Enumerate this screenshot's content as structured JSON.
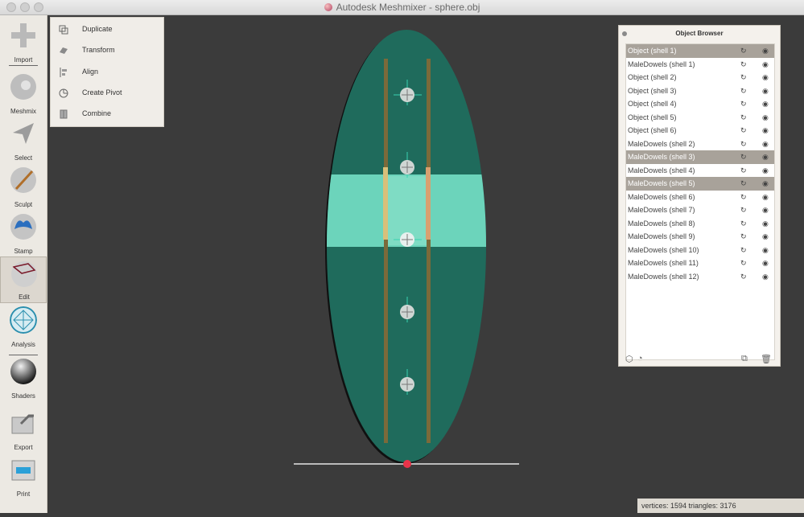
{
  "window": {
    "title": "Autodesk Meshmixer - sphere.obj"
  },
  "toolbar": {
    "items": [
      {
        "label": "Import",
        "icon": "plus-icon"
      },
      {
        "label": "Meshmix",
        "icon": "meshmix-icon"
      },
      {
        "label": "Select",
        "icon": "select-arrow-icon"
      },
      {
        "label": "Sculpt",
        "icon": "brush-icon"
      },
      {
        "label": "Stamp",
        "icon": "stamp-icon"
      },
      {
        "label": "Edit",
        "icon": "edit-icon"
      },
      {
        "label": "Analysis",
        "icon": "analysis-icon"
      },
      {
        "label": "Shaders",
        "icon": "shader-sphere-icon"
      },
      {
        "label": "Export",
        "icon": "export-icon"
      },
      {
        "label": "Print",
        "icon": "printer-icon"
      }
    ]
  },
  "edit_menu": {
    "items": [
      {
        "label": "Duplicate",
        "icon": "duplicate-icon"
      },
      {
        "label": "Transform",
        "icon": "transform-icon"
      },
      {
        "label": "Align",
        "icon": "align-icon"
      },
      {
        "label": "Create Pivot",
        "icon": "pivot-icon"
      },
      {
        "label": "Combine",
        "icon": "combine-icon"
      }
    ]
  },
  "object_browser": {
    "title": "Object Browser",
    "items": [
      {
        "label": "Object (shell 1)",
        "selected": true
      },
      {
        "label": "MaleDowels (shell 1)",
        "selected": false
      },
      {
        "label": "Object (shell 2)",
        "selected": false
      },
      {
        "label": "Object (shell 3)",
        "selected": false
      },
      {
        "label": "Object (shell 4)",
        "selected": false
      },
      {
        "label": "Object (shell 5)",
        "selected": false
      },
      {
        "label": "Object (shell 6)",
        "selected": false
      },
      {
        "label": "MaleDowels (shell 2)",
        "selected": false
      },
      {
        "label": "MaleDowels (shell 3)",
        "selected": true
      },
      {
        "label": "MaleDowels (shell 4)",
        "selected": false
      },
      {
        "label": "MaleDowels (shell 5)",
        "selected": true
      },
      {
        "label": "MaleDowels (shell 6)",
        "selected": false
      },
      {
        "label": "MaleDowels (shell 7)",
        "selected": false
      },
      {
        "label": "MaleDowels (shell 8)",
        "selected": false
      },
      {
        "label": "MaleDowels (shell 9)",
        "selected": false
      },
      {
        "label": "MaleDowels (shell 10)",
        "selected": false
      },
      {
        "label": "MaleDowels (shell 11)",
        "selected": false
      },
      {
        "label": "MaleDowels (shell 12)",
        "selected": false
      }
    ]
  },
  "status": {
    "text": "vertices: 1594 triangles: 3176"
  },
  "colors": {
    "mesh": "#1f6b5c",
    "mesh_highlight": "#6cd4bb",
    "viewport_bg": "#3b3b3b",
    "selection_row": "#a8a29a",
    "pivot_point": "#e8344a"
  }
}
